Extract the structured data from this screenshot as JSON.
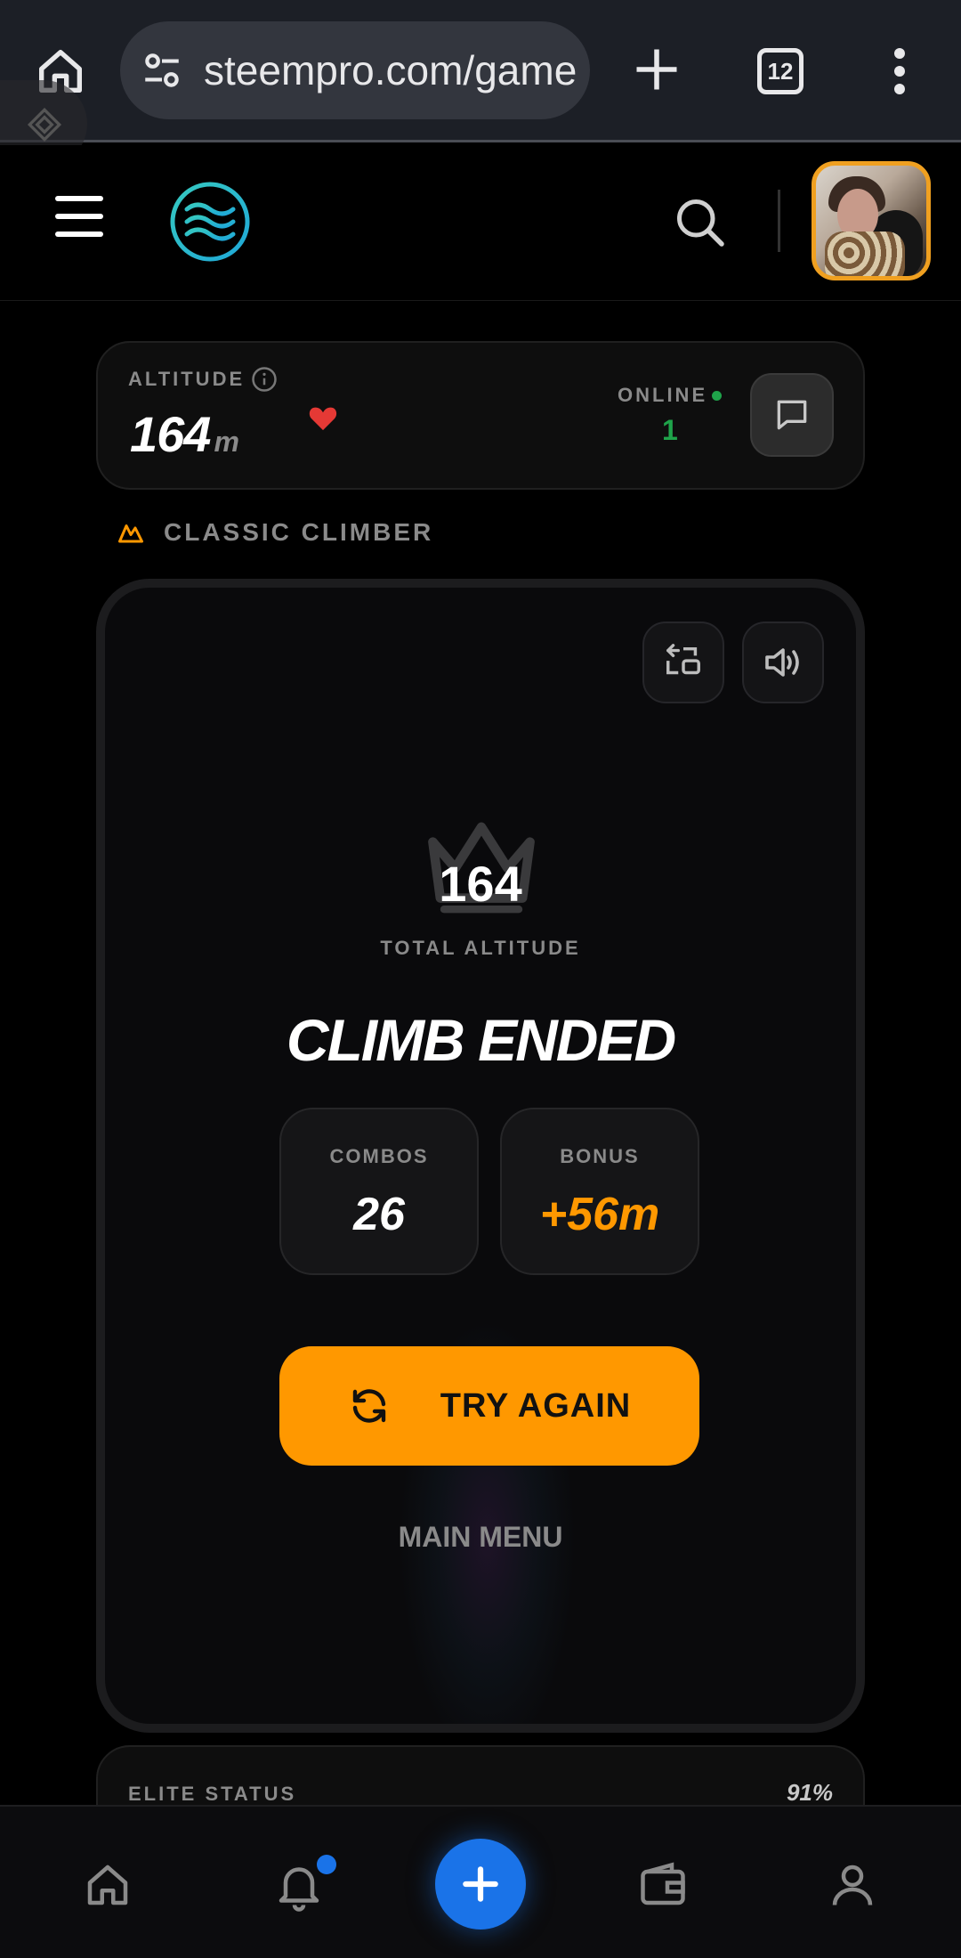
{
  "browser": {
    "url": "steempro.com/game",
    "tab_count": "12"
  },
  "stats": {
    "altitude_label": "ALTITUDE",
    "altitude_value": "164",
    "altitude_unit": "m",
    "online_label": "ONLINE",
    "online_count": "1"
  },
  "mode": {
    "label": "CLASSIC CLIMBER"
  },
  "game": {
    "total_value": "164",
    "total_label": "TOTAL ALTITUDE",
    "title": "CLIMB ENDED",
    "combos_label": "COMBOS",
    "combos_value": "26",
    "bonus_label": "BONUS",
    "bonus_value": "+56m",
    "try_again_label": "TRY AGAIN",
    "main_menu_label": "MAIN MENU"
  },
  "elite": {
    "label": "ELITE STATUS",
    "percent": "91%"
  },
  "colors": {
    "accent": "#ff9800",
    "online": "#1fa34a",
    "primary_blue": "#1a73e8",
    "heart": "#e53935"
  },
  "icons": [
    "home-icon",
    "tune-icon",
    "plus-icon",
    "tabs-icon",
    "more-vert-icon",
    "menu-icon",
    "logo-icon",
    "search-icon",
    "info-icon",
    "heart-icon",
    "chat-icon",
    "crown-icon",
    "swap-icon",
    "volume-icon",
    "refresh-icon",
    "bell-icon",
    "wallet-icon",
    "user-icon"
  ]
}
